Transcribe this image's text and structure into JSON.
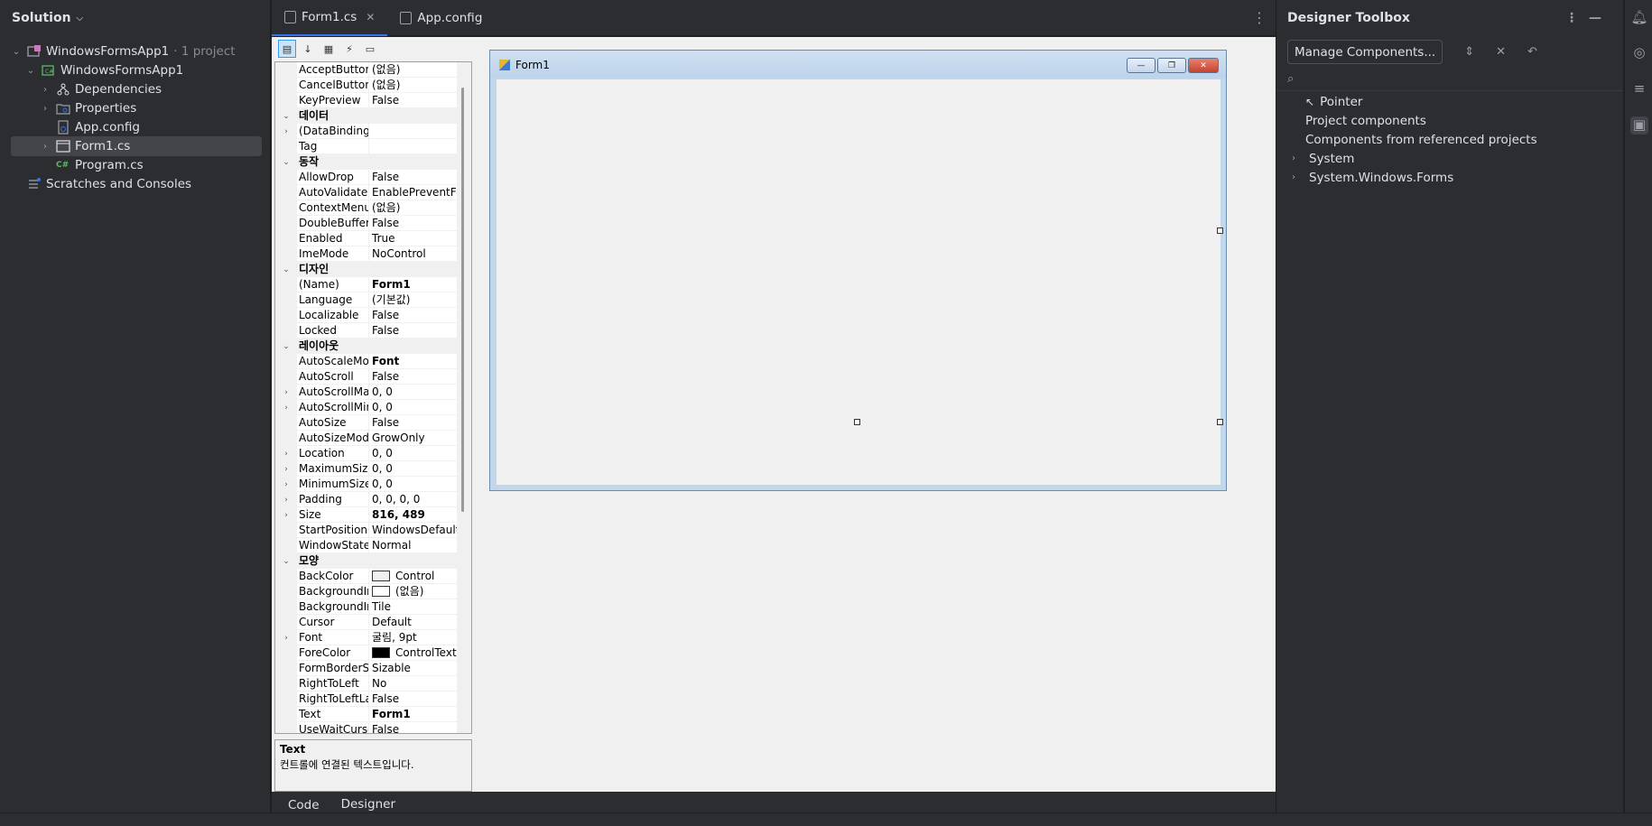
{
  "solution": {
    "header": "Solution",
    "items": [
      {
        "label": "WindowsFormsApp1",
        "suffix": "· 1 project"
      },
      {
        "label": "WindowsFormsApp1"
      },
      {
        "label": "Dependencies"
      },
      {
        "label": "Properties"
      },
      {
        "label": "App.config"
      },
      {
        "label": "Form1.cs"
      },
      {
        "label": "Program.cs"
      },
      {
        "label": "Scratches and Consoles"
      }
    ]
  },
  "tabs": [
    {
      "label": "Form1.cs",
      "close": "✕"
    },
    {
      "label": "App.config"
    }
  ],
  "properties": {
    "rows": [
      {
        "name": "AcceptButton",
        "value": "(없음)"
      },
      {
        "name": "CancelButton",
        "value": "(없음)"
      },
      {
        "name": "KeyPreview",
        "value": "False"
      },
      {
        "cat": "데이터"
      },
      {
        "name": "(DataBindings)",
        "value": "",
        "expand": true
      },
      {
        "name": "Tag",
        "value": ""
      },
      {
        "cat": "동작"
      },
      {
        "name": "AllowDrop",
        "value": "False"
      },
      {
        "name": "AutoValidate",
        "value": "EnablePreventFocusChange"
      },
      {
        "name": "ContextMenuStrip",
        "value": "(없음)"
      },
      {
        "name": "DoubleBuffered",
        "value": "False"
      },
      {
        "name": "Enabled",
        "value": "True"
      },
      {
        "name": "ImeMode",
        "value": "NoControl"
      },
      {
        "cat": "디자인"
      },
      {
        "name": "(Name)",
        "value": "Form1",
        "bold": true
      },
      {
        "name": "Language",
        "value": "(기본값)"
      },
      {
        "name": "Localizable",
        "value": "False"
      },
      {
        "name": "Locked",
        "value": "False"
      },
      {
        "cat": "레이아웃"
      },
      {
        "name": "AutoScaleMode",
        "value": "Font",
        "bold": true
      },
      {
        "name": "AutoScroll",
        "value": "False"
      },
      {
        "name": "AutoScrollMargin",
        "value": "0, 0",
        "expand": true
      },
      {
        "name": "AutoScrollMinSize",
        "value": "0, 0",
        "expand": true
      },
      {
        "name": "AutoSize",
        "value": "False"
      },
      {
        "name": "AutoSizeMode",
        "value": "GrowOnly"
      },
      {
        "name": "Location",
        "value": "0, 0",
        "expand": true
      },
      {
        "name": "MaximumSize",
        "value": "0, 0",
        "expand": true
      },
      {
        "name": "MinimumSize",
        "value": "0, 0",
        "expand": true
      },
      {
        "name": "Padding",
        "value": "0, 0, 0, 0",
        "expand": true
      },
      {
        "name": "Size",
        "value": "816, 489",
        "bold": true,
        "expand": true
      },
      {
        "name": "StartPosition",
        "value": "WindowsDefaultLocation"
      },
      {
        "name": "WindowState",
        "value": "Normal"
      },
      {
        "cat": "모양"
      },
      {
        "name": "BackColor",
        "value": "Control",
        "swatch": "#f0f0f0"
      },
      {
        "name": "BackgroundImage",
        "value": "(없음)",
        "swatch": "#ffffff"
      },
      {
        "name": "BackgroundImageLayout",
        "value": "Tile"
      },
      {
        "name": "Cursor",
        "value": "Default"
      },
      {
        "name": "Font",
        "value": "굴림, 9pt",
        "expand": true
      },
      {
        "name": "ForeColor",
        "value": "ControlText",
        "swatch": "#000000"
      },
      {
        "name": "FormBorderStyle",
        "value": "Sizable"
      },
      {
        "name": "RightToLeft",
        "value": "No"
      },
      {
        "name": "RightToLeftLayout",
        "value": "False"
      },
      {
        "name": "Text",
        "value": "Form1",
        "bold": true
      },
      {
        "name": "UseWaitCursor",
        "value": "False"
      }
    ],
    "desc_title": "Text",
    "desc_text": "컨트롤에 연결된 텍스트입니다."
  },
  "form": {
    "title": "Form1",
    "min": "—",
    "max": "❐",
    "close": "✕"
  },
  "bottom_tabs": [
    "Code",
    "Designer"
  ],
  "toolbox": {
    "header": "Designer Toolbox",
    "manage": "Manage Components...",
    "items": [
      {
        "label": "Pointer",
        "icon": "pointer-icon"
      },
      {
        "label": "Project components"
      },
      {
        "label": "Components from referenced projects"
      },
      {
        "label": "System",
        "expand": true
      },
      {
        "label": "System.Windows.Forms",
        "expand": true
      }
    ]
  }
}
